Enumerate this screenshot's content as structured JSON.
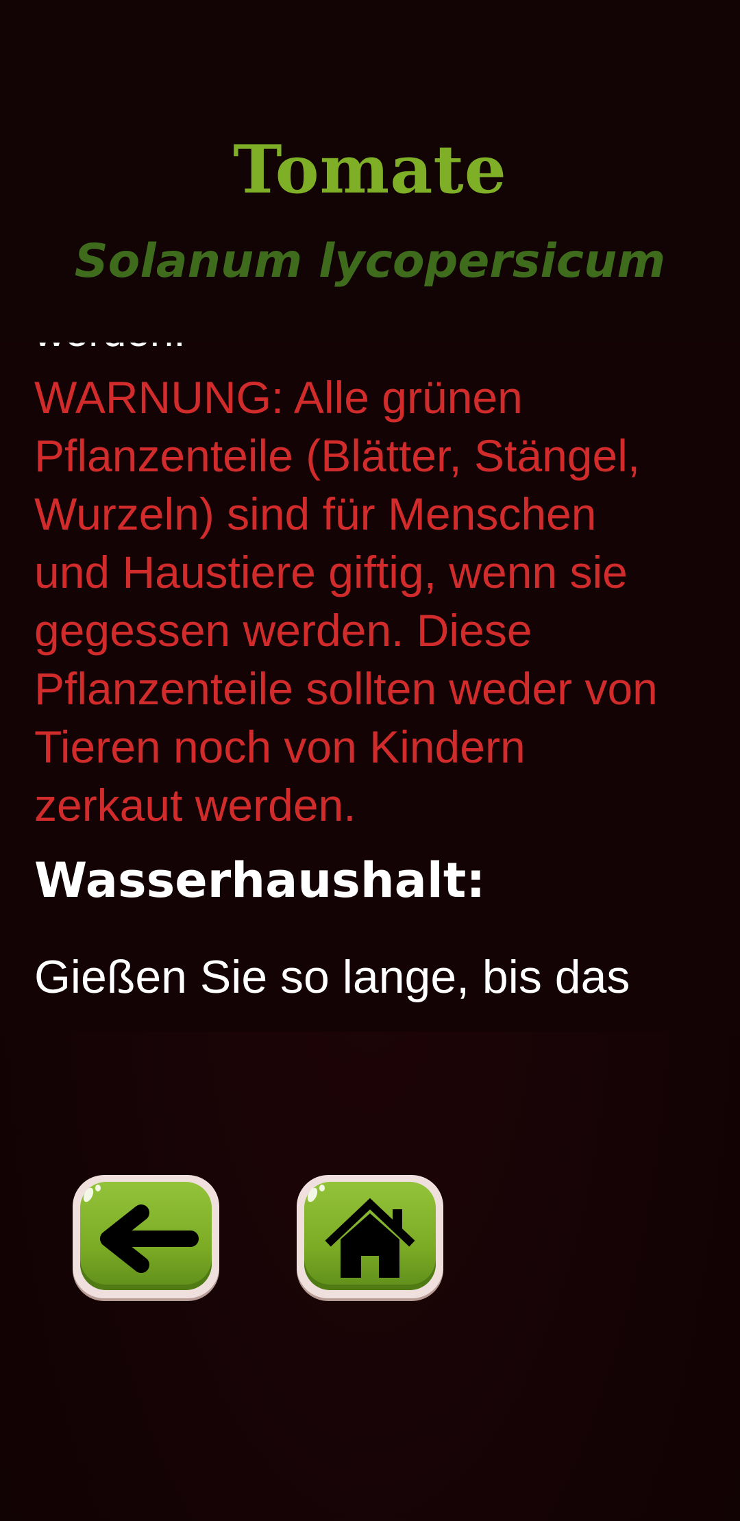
{
  "header": {
    "title": "Tomate",
    "subtitle": "Solanum lycopersicum"
  },
  "content": {
    "partial_text": "werden.",
    "warning": [
      "WARNUNG: Alle grünen",
      "Pflanzenteile (Blätter, Stängel,",
      "Wurzeln) sind für Menschen",
      "und Haustiere giftig, wenn sie",
      "gegessen werden. Diese",
      "Pflanzenteile sollten weder von",
      "Tieren noch von Kindern",
      "zerkaut werden."
    ],
    "water_heading": "Wasserhaushalt:",
    "water_text": "Gießen Sie so lange, bis das"
  },
  "nav": {
    "back_icon": "arrow-left-icon",
    "home_icon": "home-icon"
  },
  "colors": {
    "title": "#7fae27",
    "subtitle": "#3f6b1c",
    "warning": "#d22b2b",
    "background": "#150305",
    "button_green": "#7cab25"
  }
}
